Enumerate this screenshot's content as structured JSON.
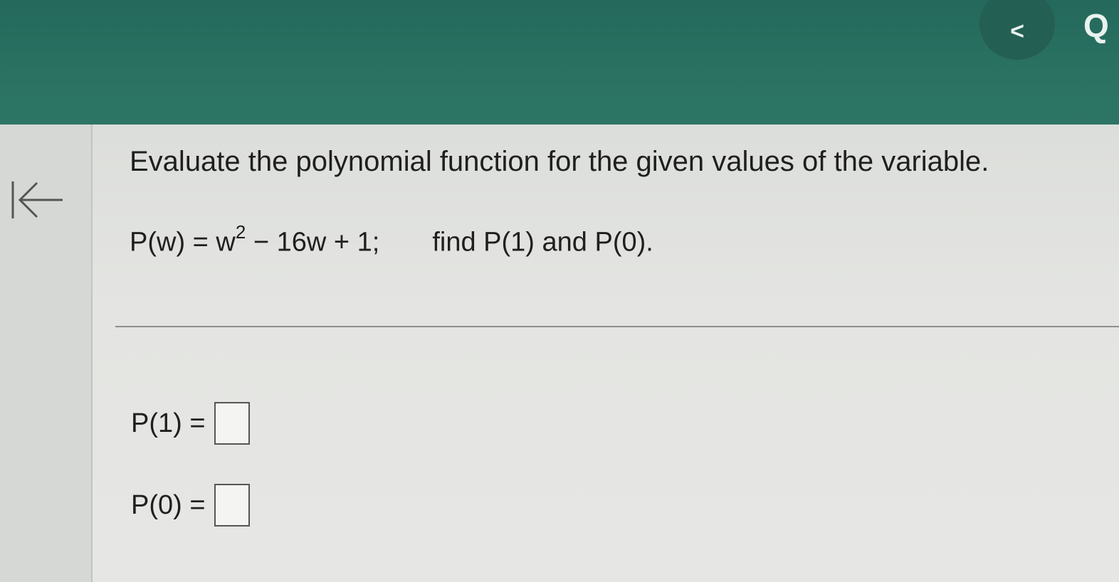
{
  "header": {
    "prev_label": "<",
    "search_label": "Q"
  },
  "sidebar": {
    "collapse_icon": "arrow-left-to-bar-icon"
  },
  "question": {
    "instruction": "Evaluate the polynomial function for the given values of the variable.",
    "function_lhs": "P(w) = w",
    "exponent": "2",
    "function_rest": " − 16w + 1;",
    "find_text": "find P(1) and P(0)."
  },
  "answers": [
    {
      "label": "P(1) =",
      "value": ""
    },
    {
      "label": "P(0) =",
      "value": ""
    }
  ],
  "colors": {
    "header_bg": "#2b7262",
    "content_bg": "#e4e5e2",
    "text": "#1f1f1f"
  }
}
